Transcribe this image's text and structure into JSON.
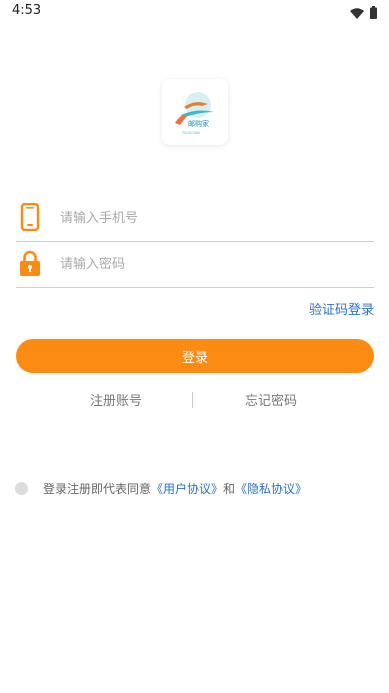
{
  "status_bar": {
    "time": "4:53"
  },
  "logo": {
    "brand_text": "邮购家",
    "sub_text": "YOUGOUJIA"
  },
  "form": {
    "phone_placeholder": "请输入手机号",
    "password_placeholder": "请输入密码",
    "sms_login_label": "验证码登录",
    "login_button_label": "登录"
  },
  "links": {
    "register_label": "注册账号",
    "divider": "|",
    "forgot_password_label": "忘记密码"
  },
  "agreement": {
    "prefix": "登录注册即代表同意",
    "user_agreement": "《用户协议》",
    "conjunction": "和",
    "privacy_agreement": "《隐私协议》",
    "accepted": false
  },
  "colors": {
    "accent": "#fb8b13",
    "link": "#2f6fc4"
  }
}
